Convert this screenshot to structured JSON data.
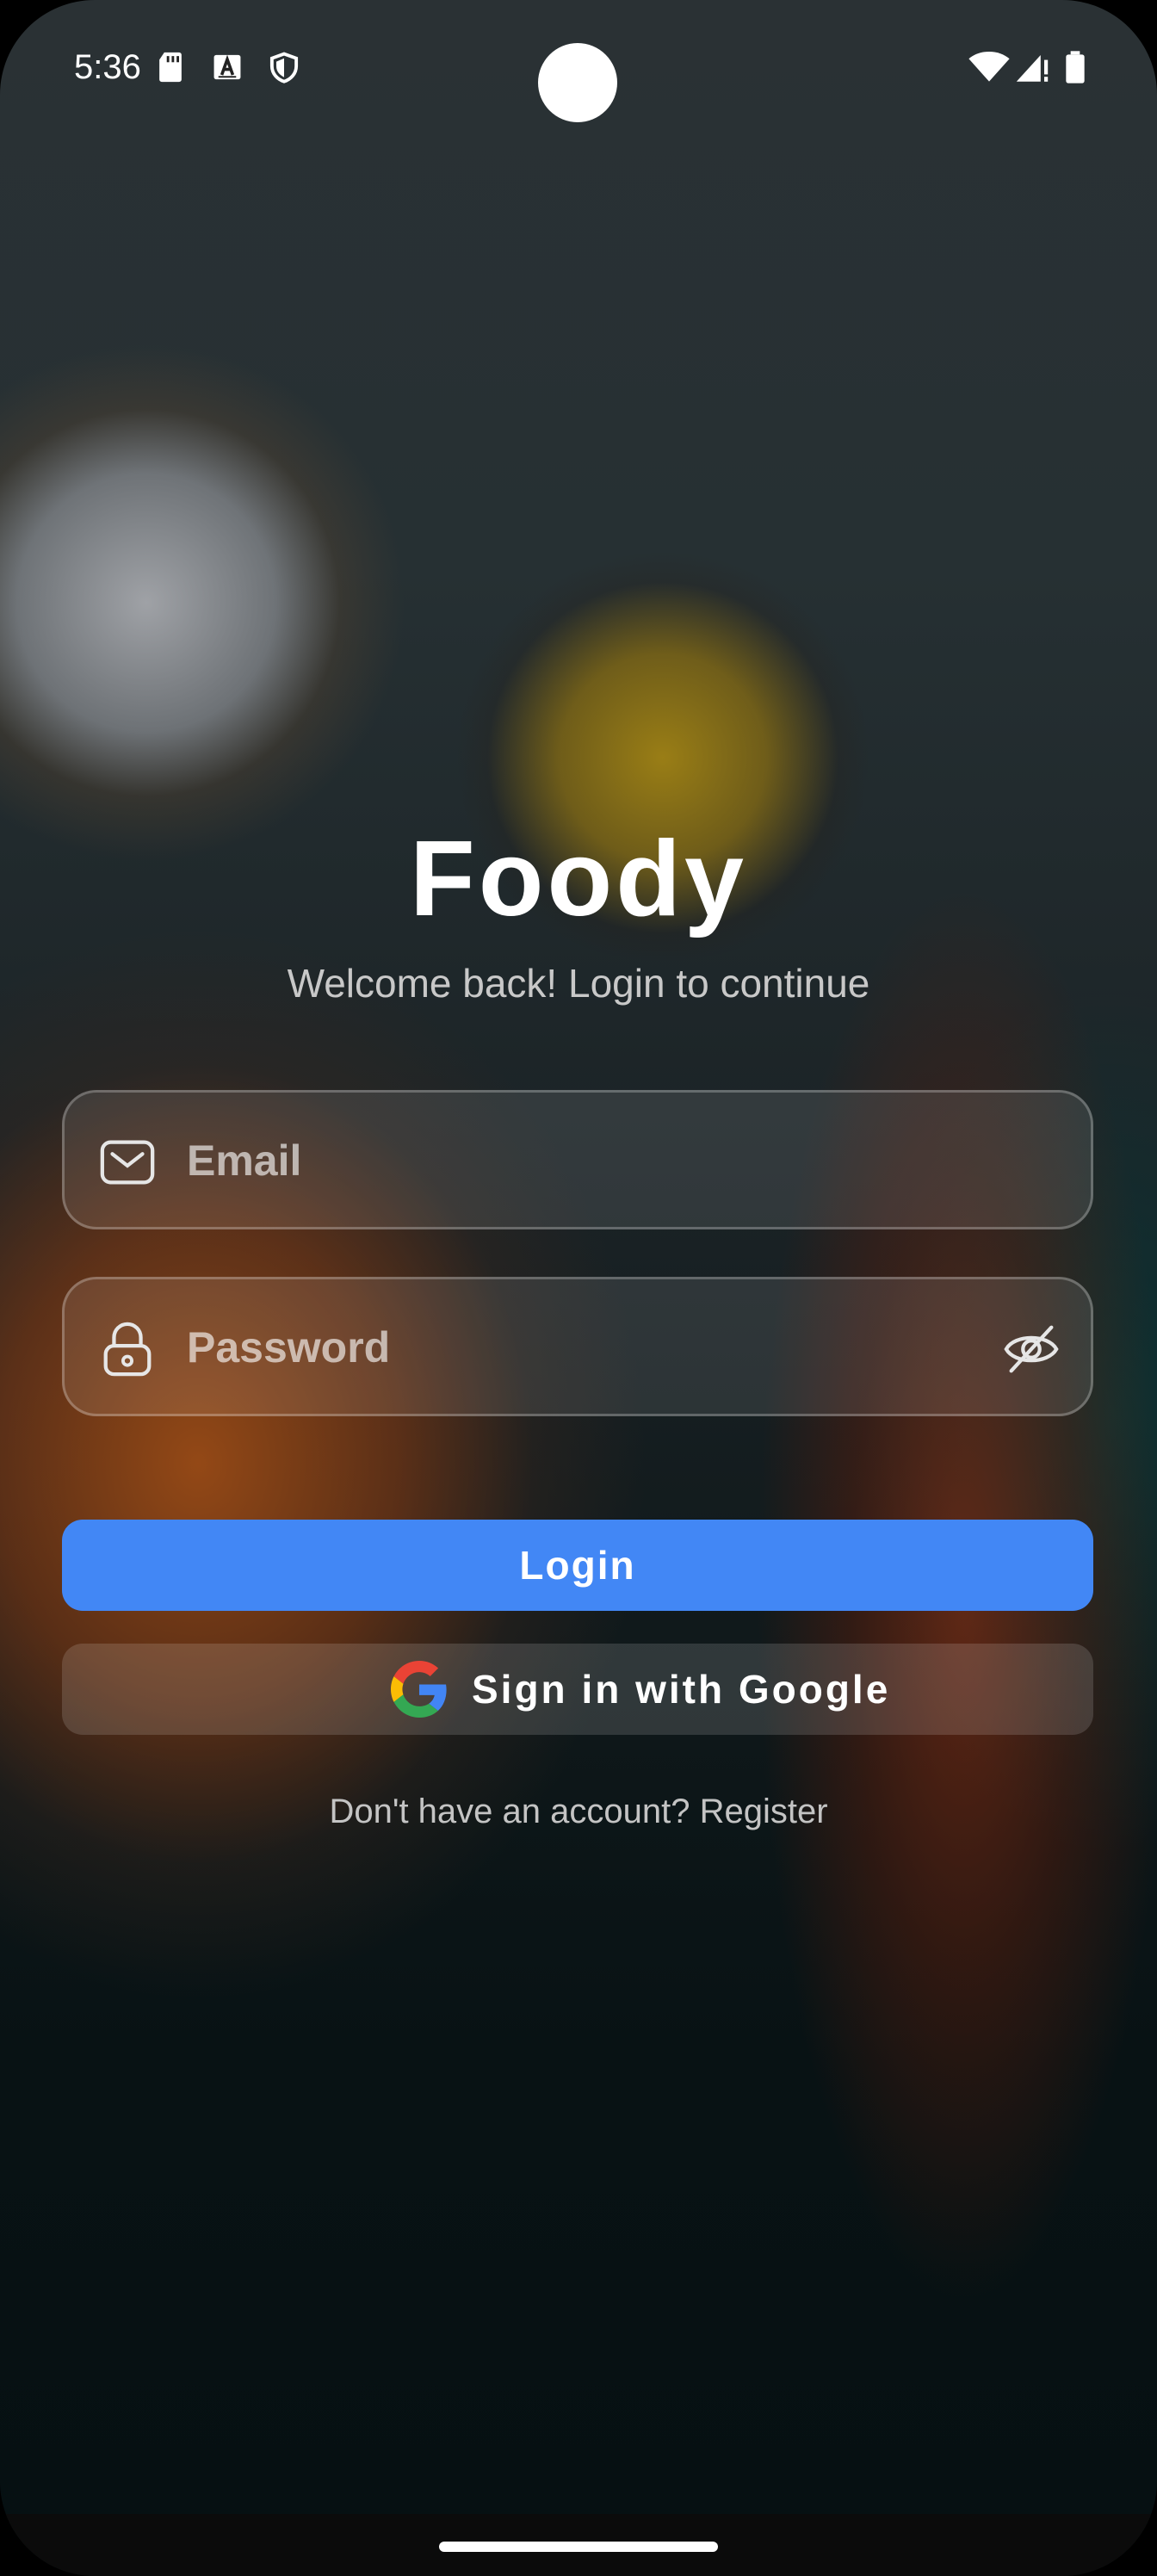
{
  "status_bar": {
    "time": "5:36",
    "left_icons": [
      "sd-card-icon",
      "keyboard-a-icon",
      "shield-icon"
    ],
    "right_icons": [
      "wifi-icon",
      "cell-signal-icon",
      "battery-icon"
    ]
  },
  "login_screen": {
    "app_name": "Foody",
    "subtitle": "Welcome back! Login to continue",
    "email": {
      "placeholder": "Email",
      "value": "",
      "icon": "mail-icon"
    },
    "password": {
      "placeholder": "Password",
      "value": "",
      "icon": "lock-icon",
      "toggle_icon": "eye-off-icon"
    },
    "login_button": "Login",
    "google_button": "Sign in with Google",
    "register_prompt": "Don't have an account? Register"
  },
  "colors": {
    "primary": "#4287f5",
    "text": "#ffffff",
    "muted_text": "#c8c8c8"
  }
}
